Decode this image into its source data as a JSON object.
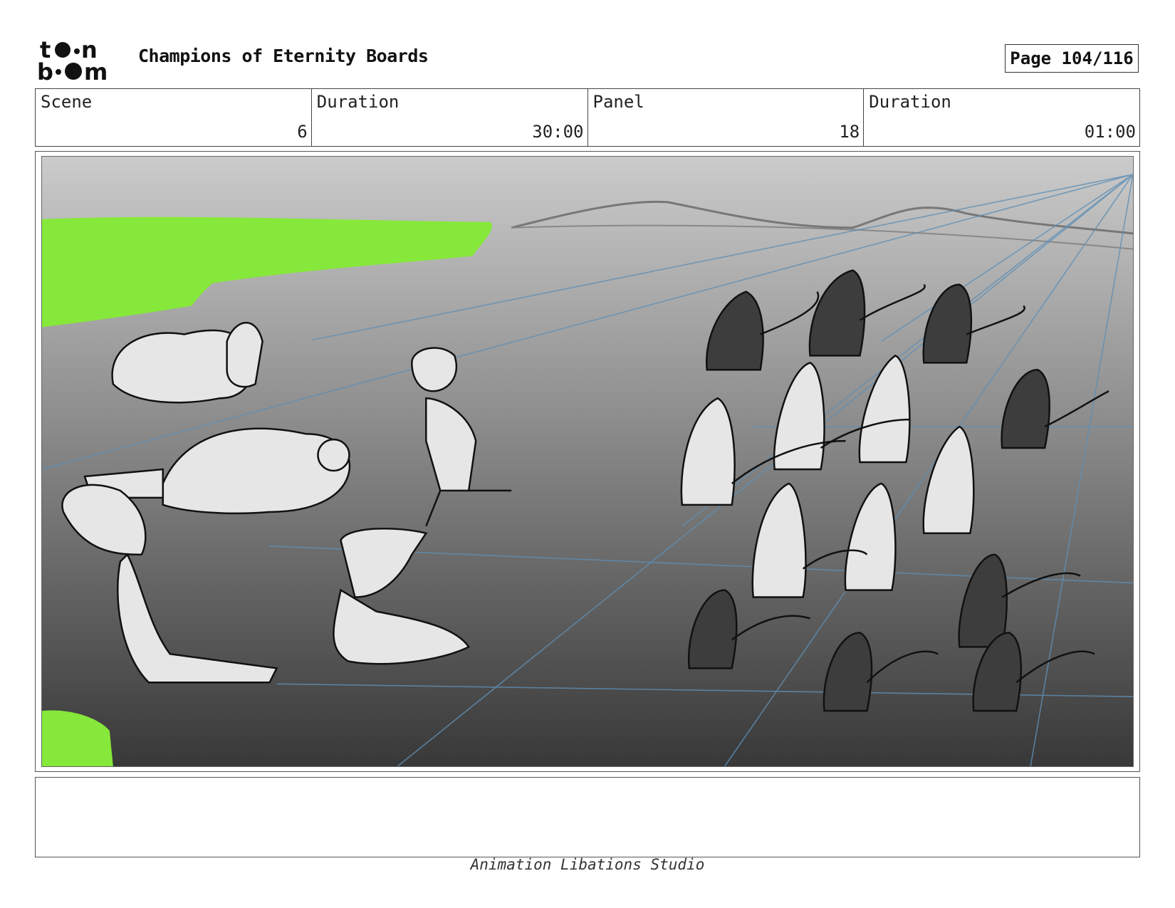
{
  "header": {
    "logo_text": "toon boom",
    "title": "Champions of Eternity Boards",
    "page": "Page 104/116"
  },
  "info": {
    "scene_label": "Scene",
    "scene_value": "6",
    "scene_duration_label": "Duration",
    "scene_duration_value": "30:00",
    "panel_label": "Panel",
    "panel_value": "18",
    "panel_duration_label": "Duration",
    "panel_duration_value": "01:00"
  },
  "panel": {
    "description": "",
    "colors": {
      "sky_top": "#c9c9c9",
      "ground_bottom": "#3a3a3a",
      "grass": "#86e83a",
      "perspective_lines": "#5f8fb5",
      "sketch": "#111111",
      "figure_fill": "#e6e6e6"
    }
  },
  "notes": {
    "text": ""
  },
  "footer": {
    "studio": "Animation Libations Studio"
  }
}
